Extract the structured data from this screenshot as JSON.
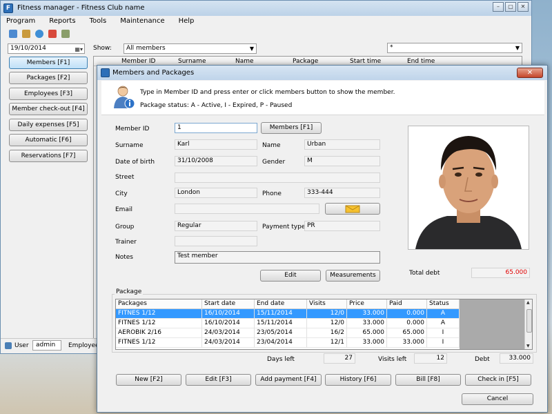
{
  "main_window": {
    "title": "Fitness manager - Fitness Club name",
    "window_buttons": [
      "–",
      "▢",
      "✕"
    ],
    "menu": [
      "Program",
      "Reports",
      "Tools",
      "Maintenance",
      "Help"
    ],
    "date": "19/10/2014",
    "show_label": "Show:",
    "show_value": "All members",
    "right_select_value": "*",
    "side_buttons": [
      "Members  [F1]",
      "Packages  [F2]",
      "Employees  [F3]",
      "Member check-out [F4]",
      "Daily expenses  [F5]",
      "Automatic  [F6]",
      "Reservations [F7]"
    ],
    "table_headers": [
      "Member ID",
      "Surname",
      "Name",
      "Package",
      "Start time",
      "End time"
    ],
    "status_user_label": "User",
    "status_user_value": "admin",
    "status_employee_label": "Employee"
  },
  "dialog": {
    "title": "Members and Packages",
    "close": "✕",
    "info_line1": "Type in Member ID and press enter or click members button to show the member.",
    "info_line2": "Package status: A - Active, I - Expired, P - Paused",
    "labels": {
      "member_id": "Member ID",
      "surname": "Surname",
      "name": "Name",
      "dob": "Date of birth",
      "gender": "Gender",
      "street": "Street",
      "city": "City",
      "phone": "Phone",
      "email": "Email",
      "group": "Group",
      "payment_type": "Payment  type",
      "trainer": "Trainer",
      "notes": "Notes",
      "total_debt": "Total debt",
      "package_group": "Package",
      "days_left": "Days left",
      "visits_left": "Visits left",
      "debt": "Debt"
    },
    "values": {
      "member_id": "1",
      "surname": "Karl",
      "name": "Urban",
      "dob": "31/10/2008",
      "gender": "M",
      "street": "",
      "city": "London",
      "phone": "333-444",
      "email": "",
      "group": "Regular",
      "payment_type": "PR",
      "trainer": "",
      "notes": "Test member",
      "total_debt": "65.000",
      "days_left": "27",
      "visits_left": "12",
      "debt": "33.000"
    },
    "buttons": {
      "members": "Members  [F1]",
      "edit": "Edit",
      "measurements": "Measurements",
      "new": "New [F2]",
      "edit_f3": "Edit  [F3]",
      "add_payment": "Add payment [F4]",
      "history": "History [F6]",
      "bill": "Bill [F8]",
      "check_in": "Check in [F5]",
      "cancel": "Cancel"
    },
    "packages_table": {
      "headers": [
        "Packages",
        "Start date",
        "End date",
        "Visits",
        "Price",
        "Paid",
        "Status"
      ],
      "rows": [
        [
          "FITNES 1/12",
          "16/10/2014",
          "15/11/2014",
          "12/0",
          "33.000",
          "0.000",
          "A"
        ],
        [
          "FITNES 1/12",
          "16/10/2014",
          "15/11/2014",
          "12/0",
          "33.000",
          "0.000",
          "A"
        ],
        [
          "AEROBIK 2/16",
          "24/03/2014",
          "23/05/2014",
          "16/2",
          "65.000",
          "65.000",
          "I"
        ],
        [
          "FITNES 1/12",
          "24/03/2014",
          "23/04/2014",
          "12/1",
          "33.000",
          "33.000",
          "I"
        ]
      ],
      "selected_row": 0
    },
    "colors": {
      "debt_value": "#e00000",
      "selection": "#3399ff"
    }
  }
}
